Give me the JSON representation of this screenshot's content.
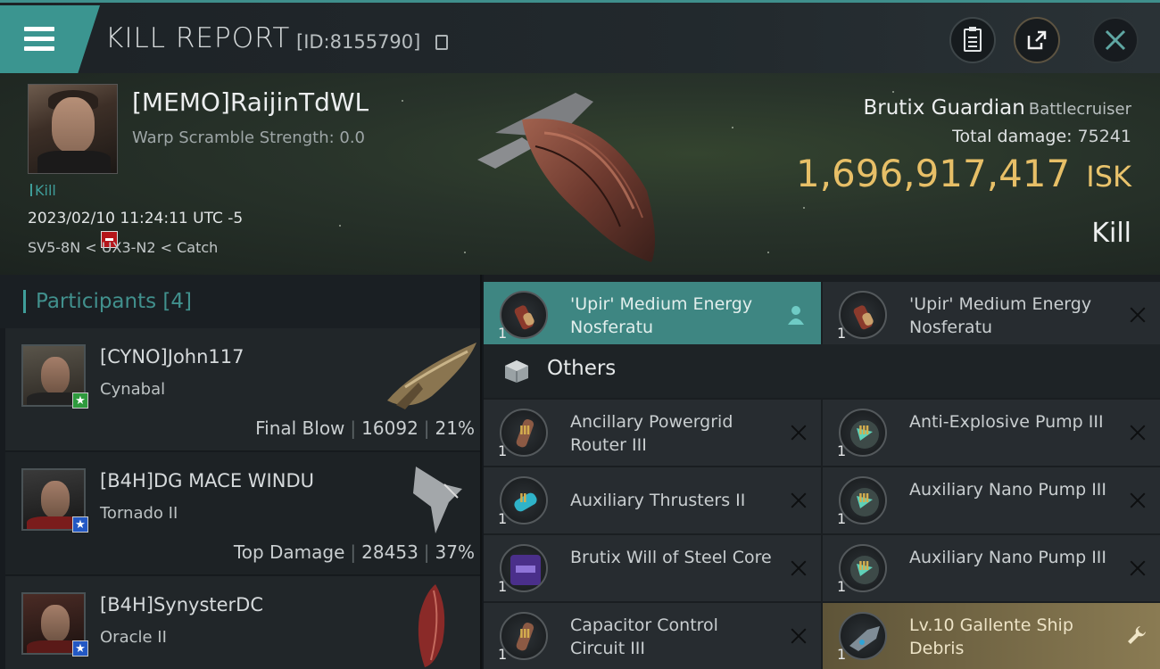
{
  "header": {
    "title": "KILL REPORT",
    "id_label": "[ID:8155790]",
    "icons": [
      "menu-icon",
      "clipboard-icon",
      "share-icon",
      "close-icon"
    ]
  },
  "victim": {
    "name": "[MEMO]RaijinTdWL",
    "warp_scramble": "Warp Scramble Strength: 0.0",
    "kill_tag": "Kill",
    "datetime": "2023/02/10 11:24:11 UTC -5",
    "route": "SV5-8N < UX3-N2 < Catch",
    "ship_name": "Brutix Guardian",
    "ship_class": "Battlecruiser",
    "total_damage_label": "Total damage:",
    "total_damage": "75241",
    "isk_value": "1,696,917,417",
    "isk_unit": "ISK",
    "result": "Kill"
  },
  "participants": {
    "label": "Participants",
    "count": "[4]",
    "rows": [
      {
        "name": "[CYNO]John117",
        "ship": "Cynabal",
        "role": "Final Blow",
        "damage": "16092",
        "percent": "21%",
        "badge": "green-star"
      },
      {
        "name": "[B4H]DG MACE WINDU",
        "ship": "Tornado II",
        "role": "Top Damage",
        "damage": "28453",
        "percent": "37%",
        "badge": "blue-star"
      },
      {
        "name": "[B4H]SynysterDC",
        "ship": "Oracle II",
        "role": "",
        "damage": "",
        "percent": "",
        "badge": "blue-star"
      }
    ]
  },
  "items": {
    "top_left": {
      "name": "'Upir' Medium Energy Nosferatu",
      "qty": "1"
    },
    "top_right": {
      "name": "'Upir' Medium Energy Nosferatu",
      "qty": "1"
    },
    "section": "Others",
    "grid": [
      {
        "name": "Ancillary Powergrid Router III",
        "qty": "1",
        "mark": "III"
      },
      {
        "name": "Anti-Explosive Pump III",
        "qty": "1",
        "mark": "III"
      },
      {
        "name": "Auxiliary Thrusters II",
        "qty": "1",
        "mark": "II"
      },
      {
        "name": "Auxiliary Nano Pump III",
        "qty": "1",
        "mark": "III"
      },
      {
        "name": "Brutix Will of Steel Core",
        "qty": "1",
        "mark": ""
      },
      {
        "name": "Auxiliary Nano Pump III",
        "qty": "1",
        "mark": "III"
      },
      {
        "name": "Capacitor Control Circuit III",
        "qty": "1",
        "mark": "III"
      },
      {
        "name": "Lv.10 Gallente Ship Debris",
        "qty": "1",
        "mark": ""
      }
    ]
  },
  "colors": {
    "accent": "#3f9e9a",
    "isk": "#e7bf67",
    "highlight": "#3e8682"
  }
}
